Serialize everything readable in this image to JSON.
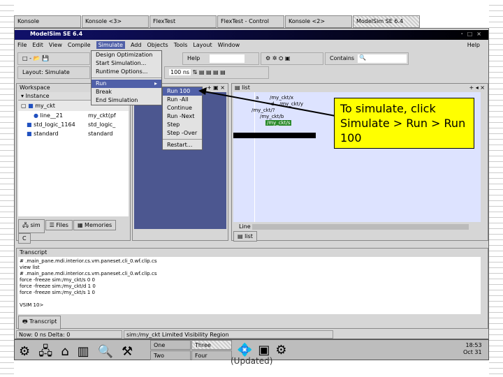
{
  "taskbar_tabs": [
    "Konsole",
    "Konsole <3>",
    "FlexTest",
    "FlexTest - Control",
    "Konsole <2>",
    "ModelSim SE 6.4"
  ],
  "window": {
    "title": "ModelSim SE 6.4",
    "controls": [
      "·",
      "□",
      "×"
    ]
  },
  "menubar": [
    "File",
    "Edit",
    "View",
    "Compile",
    "Simulate",
    "Add",
    "Objects",
    "Tools",
    "Layout",
    "Window",
    "Help"
  ],
  "toolbar": {
    "help_label": "Help",
    "contains_label": "Contains",
    "layout_label": "Layout",
    "layout_value": "Simulate",
    "run_length": "100 ns"
  },
  "simulate_menu": [
    "Design Optimization",
    "Start Simulation...",
    "Runtime Options...",
    "Run",
    "Break",
    "End Simulation"
  ],
  "run_submenu": [
    "Run 100",
    "Run -All",
    "Continue",
    "Run -Next",
    "Step",
    "Step -Over",
    "Restart..."
  ],
  "workspace": {
    "title": "Workspace",
    "column": "Instance",
    "rows": [
      {
        "name": "my_ckt",
        "unit": ""
      },
      {
        "name": "line__21",
        "unit": "my_ckt(pf"
      },
      {
        "name": "std_logic_1164",
        "unit": "std_logic_"
      },
      {
        "name": "standard",
        "unit": "standard"
      }
    ],
    "tabs": [
      "sim",
      "Files",
      "Memories",
      "C"
    ]
  },
  "list": {
    "title": "list",
    "signals": [
      "a",
      "/my_ckt/x",
      "d",
      "/my_ckt/y",
      "/my_ckt/?",
      "/my_ckt/b",
      "/my_ckt/s"
    ],
    "line_label": "Line",
    "tab": "list"
  },
  "transcript": {
    "title": "Transcript",
    "lines": [
      "# .main_pane.mdi.interior.cs.vm.paneset.cli_0.wf.clip.cs",
      "view list",
      "# .main_pane.mdi.interior.cs.vm.paneset.cli_0.wf.clip.cs",
      "force -freeze sim:/my_ckt/s 0 0",
      "force -freeze sim:/my_ckt/d 1 0",
      "force -freeze sim:/my_ckt/s 1 0",
      "",
      "VSIM 10>"
    ],
    "tab": "Transcript"
  },
  "status": {
    "now": "Now: 0 ns  Delta: 0",
    "region": "sim:/my_ckt  Limited Visibility Region"
  },
  "kde_panel": {
    "desktops": [
      "One",
      "Two",
      "Three",
      "Four"
    ],
    "time": "18:53",
    "date": "Oct 31"
  },
  "callout": "To simulate, click Simulate > Run > Run 100",
  "footer": "(Updated)"
}
